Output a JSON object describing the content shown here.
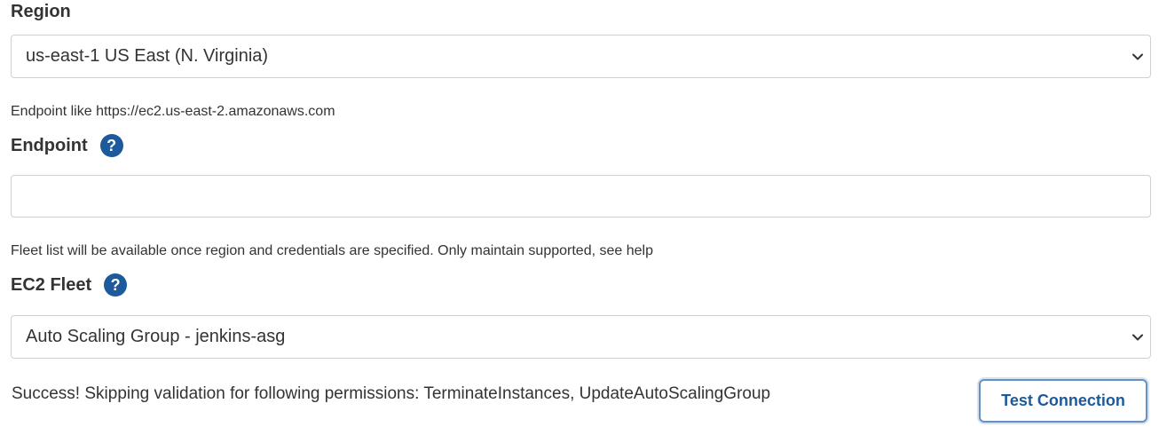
{
  "region": {
    "label": "Region",
    "selected": "us-east-1 US East (N. Virginia)"
  },
  "endpoint": {
    "hint": "Endpoint like https://ec2.us-east-2.amazonaws.com",
    "label": "Endpoint",
    "help": "?",
    "value": "",
    "placeholder": ""
  },
  "fleet": {
    "hint": "Fleet list will be available once region and credentials are specified. Only maintain supported, see help",
    "label": "EC2 Fleet",
    "help": "?",
    "selected": "Auto Scaling Group - jenkins-asg"
  },
  "status": {
    "message": "Success! Skipping validation for following permissions: TerminateInstances, UpdateAutoScalingGroup"
  },
  "actions": {
    "test_connection_label": "Test Connection"
  },
  "colors": {
    "accent": "#1c5a9c",
    "border": "#d0d0d0",
    "text": "#333333"
  },
  "icons": {
    "help": "help-icon",
    "dropdown": "chevron-down-icon"
  }
}
